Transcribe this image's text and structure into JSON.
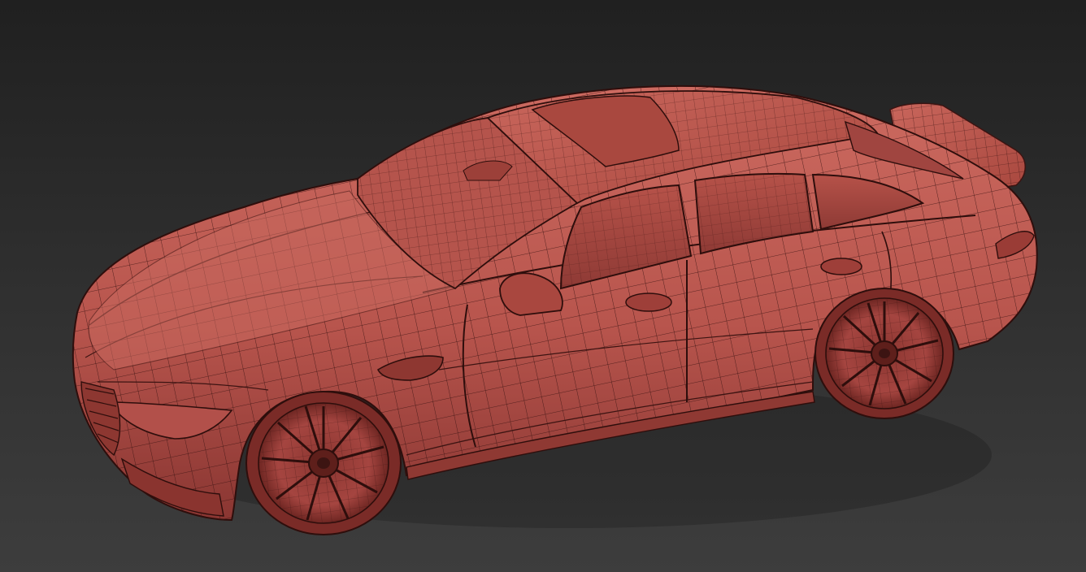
{
  "viewport": {
    "background_top": "#202020",
    "background_bottom": "#3d3d3d"
  },
  "model": {
    "display_mode": "wireframe-on-shaded",
    "body_color": "#b8554d",
    "body_shadow_color": "#7a2e2a",
    "body_highlight_color": "#cc6a60",
    "glass_color": "#a8504b",
    "wire_color": "#3c1412"
  }
}
